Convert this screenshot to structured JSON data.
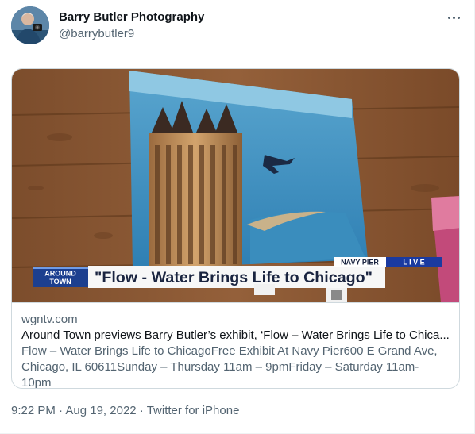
{
  "author": {
    "display_name": "Barry Butler Photography",
    "handle": "@barrybutler9",
    "avatar_icon": "person-with-camera-avatar"
  },
  "more_icon": "more-options-icon",
  "card": {
    "image": {
      "lower_third_tag_line1": "AROUND",
      "lower_third_tag_line2": "TOWN",
      "lower_third_headline": "\"Flow - Water Brings Life to Chicago\"",
      "location_label": "NAVY PIER",
      "live_label": "L I V E"
    },
    "domain": "wgntv.com",
    "title": "Around Town previews Barry Butler’s exhibit, ‘Flow – Water Brings Life to Chica...",
    "description": "Flow – Water Brings Life to ChicagoFree Exhibit At Navy Pier600 E Grand Ave, Chicago, IL 60611Sunday – Thursday 11am – 9pmFriday – Saturday 11am- 10pm"
  },
  "meta": {
    "time": "9:22 PM",
    "separator1": " · ",
    "date": "Aug 19, 2022",
    "separator2": " · ",
    "source": "Twitter for iPhone"
  },
  "colors": {
    "text_primary": "#0f1419",
    "text_secondary": "#536471",
    "border": "#cfd9de",
    "lower_third_blue": "#1c3f8f",
    "live_blue": "#1a3aa0"
  }
}
